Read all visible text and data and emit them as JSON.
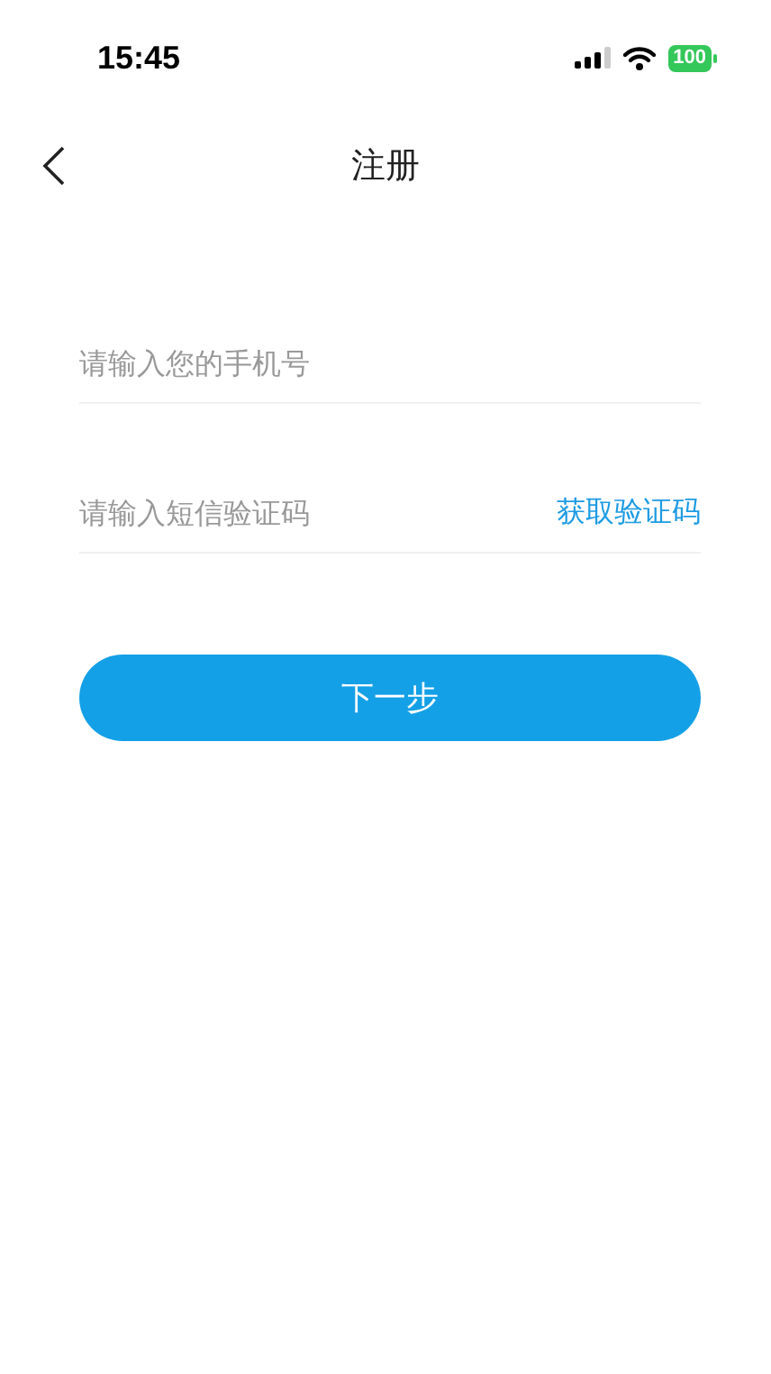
{
  "status_bar": {
    "time": "15:45",
    "battery": "100"
  },
  "nav": {
    "title": "注册"
  },
  "fields": [
    {
      "placeholder": "请输入您的手机号"
    },
    {
      "placeholder": "请输入短信验证码",
      "action": "获取验证码"
    }
  ],
  "submit": {
    "label": "下一步"
  }
}
